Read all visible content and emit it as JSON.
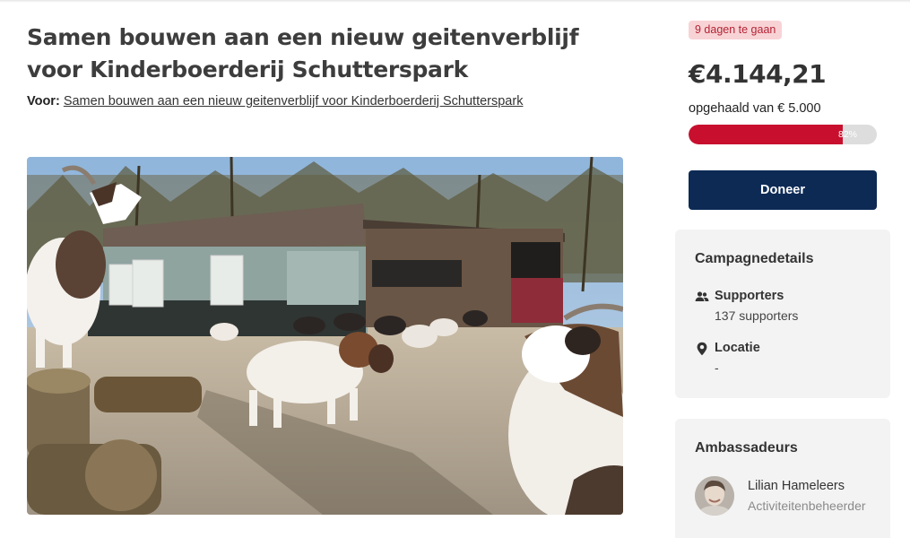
{
  "campaign": {
    "title": "Samen bouwen aan een nieuw geitenverblijf voor Kinderboerderij Schutterspark",
    "for_label": "Voor:",
    "for_link": "Samen bouwen aan een nieuw geitenverblijf voor Kinderboerderij Schutterspark"
  },
  "funding": {
    "days_left": "9 dagen te gaan",
    "amount_raised": "€4.144,21",
    "goal_text": "opgehaald van € 5.000",
    "progress_percent": 82,
    "progress_label": "82%",
    "donate_label": "Doneer"
  },
  "details": {
    "title": "Campagnedetails",
    "supporters_label": "Supporters",
    "supporters_value": "137 supporters",
    "location_label": "Locatie",
    "location_value": "-"
  },
  "ambassadors": {
    "title": "Ambassadeurs",
    "items": [
      {
        "name": "Lilian Hameleers",
        "role": "Activiteitenbeheerder"
      }
    ]
  },
  "colors": {
    "accent_red": "#c8102e",
    "navy": "#0d2a55",
    "badge_bg": "#f8d3d6",
    "badge_text": "#b42333"
  }
}
